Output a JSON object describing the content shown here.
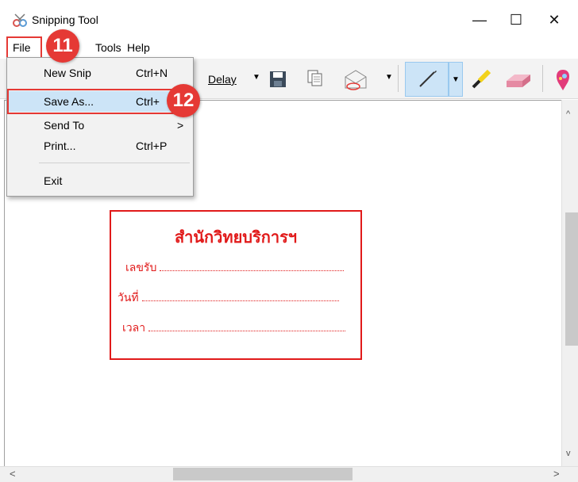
{
  "window": {
    "title": "Snipping Tool",
    "minimize": "—",
    "maximize": "☐",
    "close": "✕"
  },
  "menubar": {
    "file": "File",
    "tools": "Tools",
    "help": "Help"
  },
  "toolbar": {
    "delay": "Delay"
  },
  "file_menu": {
    "items": [
      {
        "label": "New Snip",
        "shortcut": "Ctrl+N"
      },
      {
        "label": "Save As...",
        "shortcut": "Ctrl+"
      },
      {
        "label": "Send To",
        "shortcut": ">"
      },
      {
        "label": "Print...",
        "shortcut": "Ctrl+P"
      },
      {
        "label": "Exit",
        "shortcut": ""
      }
    ]
  },
  "annotations": {
    "badge_11": "11",
    "badge_12": "12"
  },
  "stamp": {
    "title": "สำนักวิทยบริการฯ",
    "line1": "เลขรับ",
    "line2": "วันที่",
    "line3": "เวลา"
  },
  "colors": {
    "stamp_red": "#e11a1a",
    "highlight_blue": "#cce4f7",
    "badge_red": "#e53935"
  }
}
